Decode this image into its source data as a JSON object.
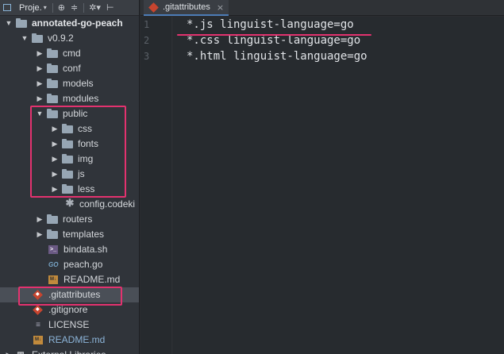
{
  "toolbar": {
    "project_label": "Proje.",
    "icons": [
      "project-icon",
      "sync-icon",
      "collapse-icon",
      "settings-icon",
      "hide-icon"
    ]
  },
  "tree": [
    {
      "name": "annotated-go-peach",
      "type": "folder",
      "expanded": true,
      "depth": 0,
      "bold": true
    },
    {
      "name": "v0.9.2",
      "type": "folder",
      "expanded": true,
      "depth": 1
    },
    {
      "name": "cmd",
      "type": "folder",
      "expanded": false,
      "depth": 2
    },
    {
      "name": "conf",
      "type": "folder",
      "expanded": false,
      "depth": 2
    },
    {
      "name": "models",
      "type": "folder",
      "expanded": false,
      "depth": 2
    },
    {
      "name": "modules",
      "type": "folder",
      "expanded": false,
      "depth": 2
    },
    {
      "name": "public",
      "type": "folder",
      "expanded": true,
      "depth": 2
    },
    {
      "name": "css",
      "type": "folder",
      "expanded": false,
      "depth": 3
    },
    {
      "name": "fonts",
      "type": "folder",
      "expanded": false,
      "depth": 3
    },
    {
      "name": "img",
      "type": "folder",
      "expanded": false,
      "depth": 3
    },
    {
      "name": "js",
      "type": "folder",
      "expanded": false,
      "depth": 3
    },
    {
      "name": "less",
      "type": "folder",
      "expanded": false,
      "depth": 3
    },
    {
      "name": "config.codeki",
      "type": "file",
      "icon": "star",
      "depth": 3
    },
    {
      "name": "routers",
      "type": "folder",
      "expanded": false,
      "depth": 2
    },
    {
      "name": "templates",
      "type": "folder",
      "expanded": false,
      "depth": 2
    },
    {
      "name": "bindata.sh",
      "type": "file",
      "icon": "sh",
      "depth": 2
    },
    {
      "name": "peach.go",
      "type": "file",
      "icon": "go",
      "depth": 2
    },
    {
      "name": "README.md",
      "type": "file",
      "icon": "md",
      "depth": 2
    },
    {
      "name": ".gitattributes",
      "type": "file",
      "icon": "git",
      "depth": 1,
      "selected": true
    },
    {
      "name": ".gitignore",
      "type": "file",
      "icon": "git",
      "depth": 1
    },
    {
      "name": "LICENSE",
      "type": "file",
      "icon": "lic",
      "depth": 1
    },
    {
      "name": "README.md",
      "type": "file",
      "icon": "md",
      "depth": 1,
      "color": "#8cb4d8"
    },
    {
      "name": "External Libraries",
      "type": "lib",
      "depth": 0
    }
  ],
  "editor": {
    "tab_label": ".gitattributes",
    "tab_close": "×",
    "line_numbers": [
      "1",
      "2",
      "3"
    ],
    "lines": [
      "*.js linguist-language=go",
      "*.css linguist-language=go",
      "*.html linguist-language=go"
    ]
  },
  "colors": {
    "annotation": "#e3326f",
    "tab_accent": "#4c7cb6"
  }
}
